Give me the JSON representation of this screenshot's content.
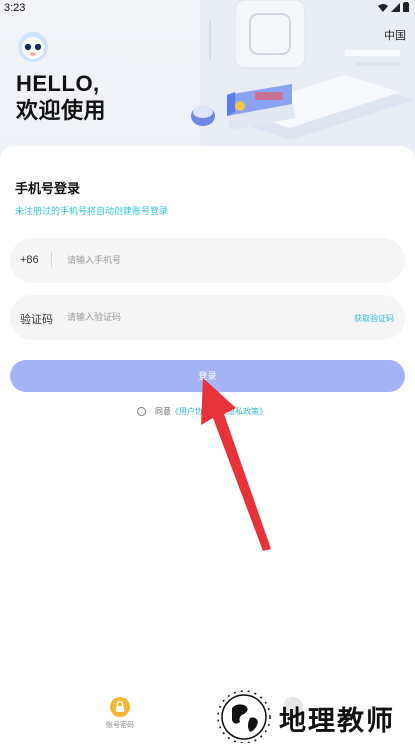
{
  "status_bar": {
    "time": "3:23"
  },
  "header": {
    "greeting_line1": "HELLO,",
    "greeting_line2": "欢迎使用",
    "region": "中国"
  },
  "login": {
    "title": "手机号登录",
    "subtitle": "未注册过的手机号将自动创建账号登录",
    "phone_prefix": "+86",
    "phone_placeholder": "请输入手机号",
    "code_label": "验证码",
    "code_placeholder": "请输入验证码",
    "get_code": "获取验证码",
    "login_button": "登录"
  },
  "agreement": {
    "agree_text": "同意",
    "user_agreement": "《用户协议》",
    "privacy_policy": "《隐私政策》"
  },
  "other_login": {
    "password_login": "账号密码"
  },
  "watermark": {
    "text": "地理教师"
  },
  "colors": {
    "accent": "#36b9d3",
    "login_button": "#a4b4f6",
    "arrow": "#e8323a"
  }
}
